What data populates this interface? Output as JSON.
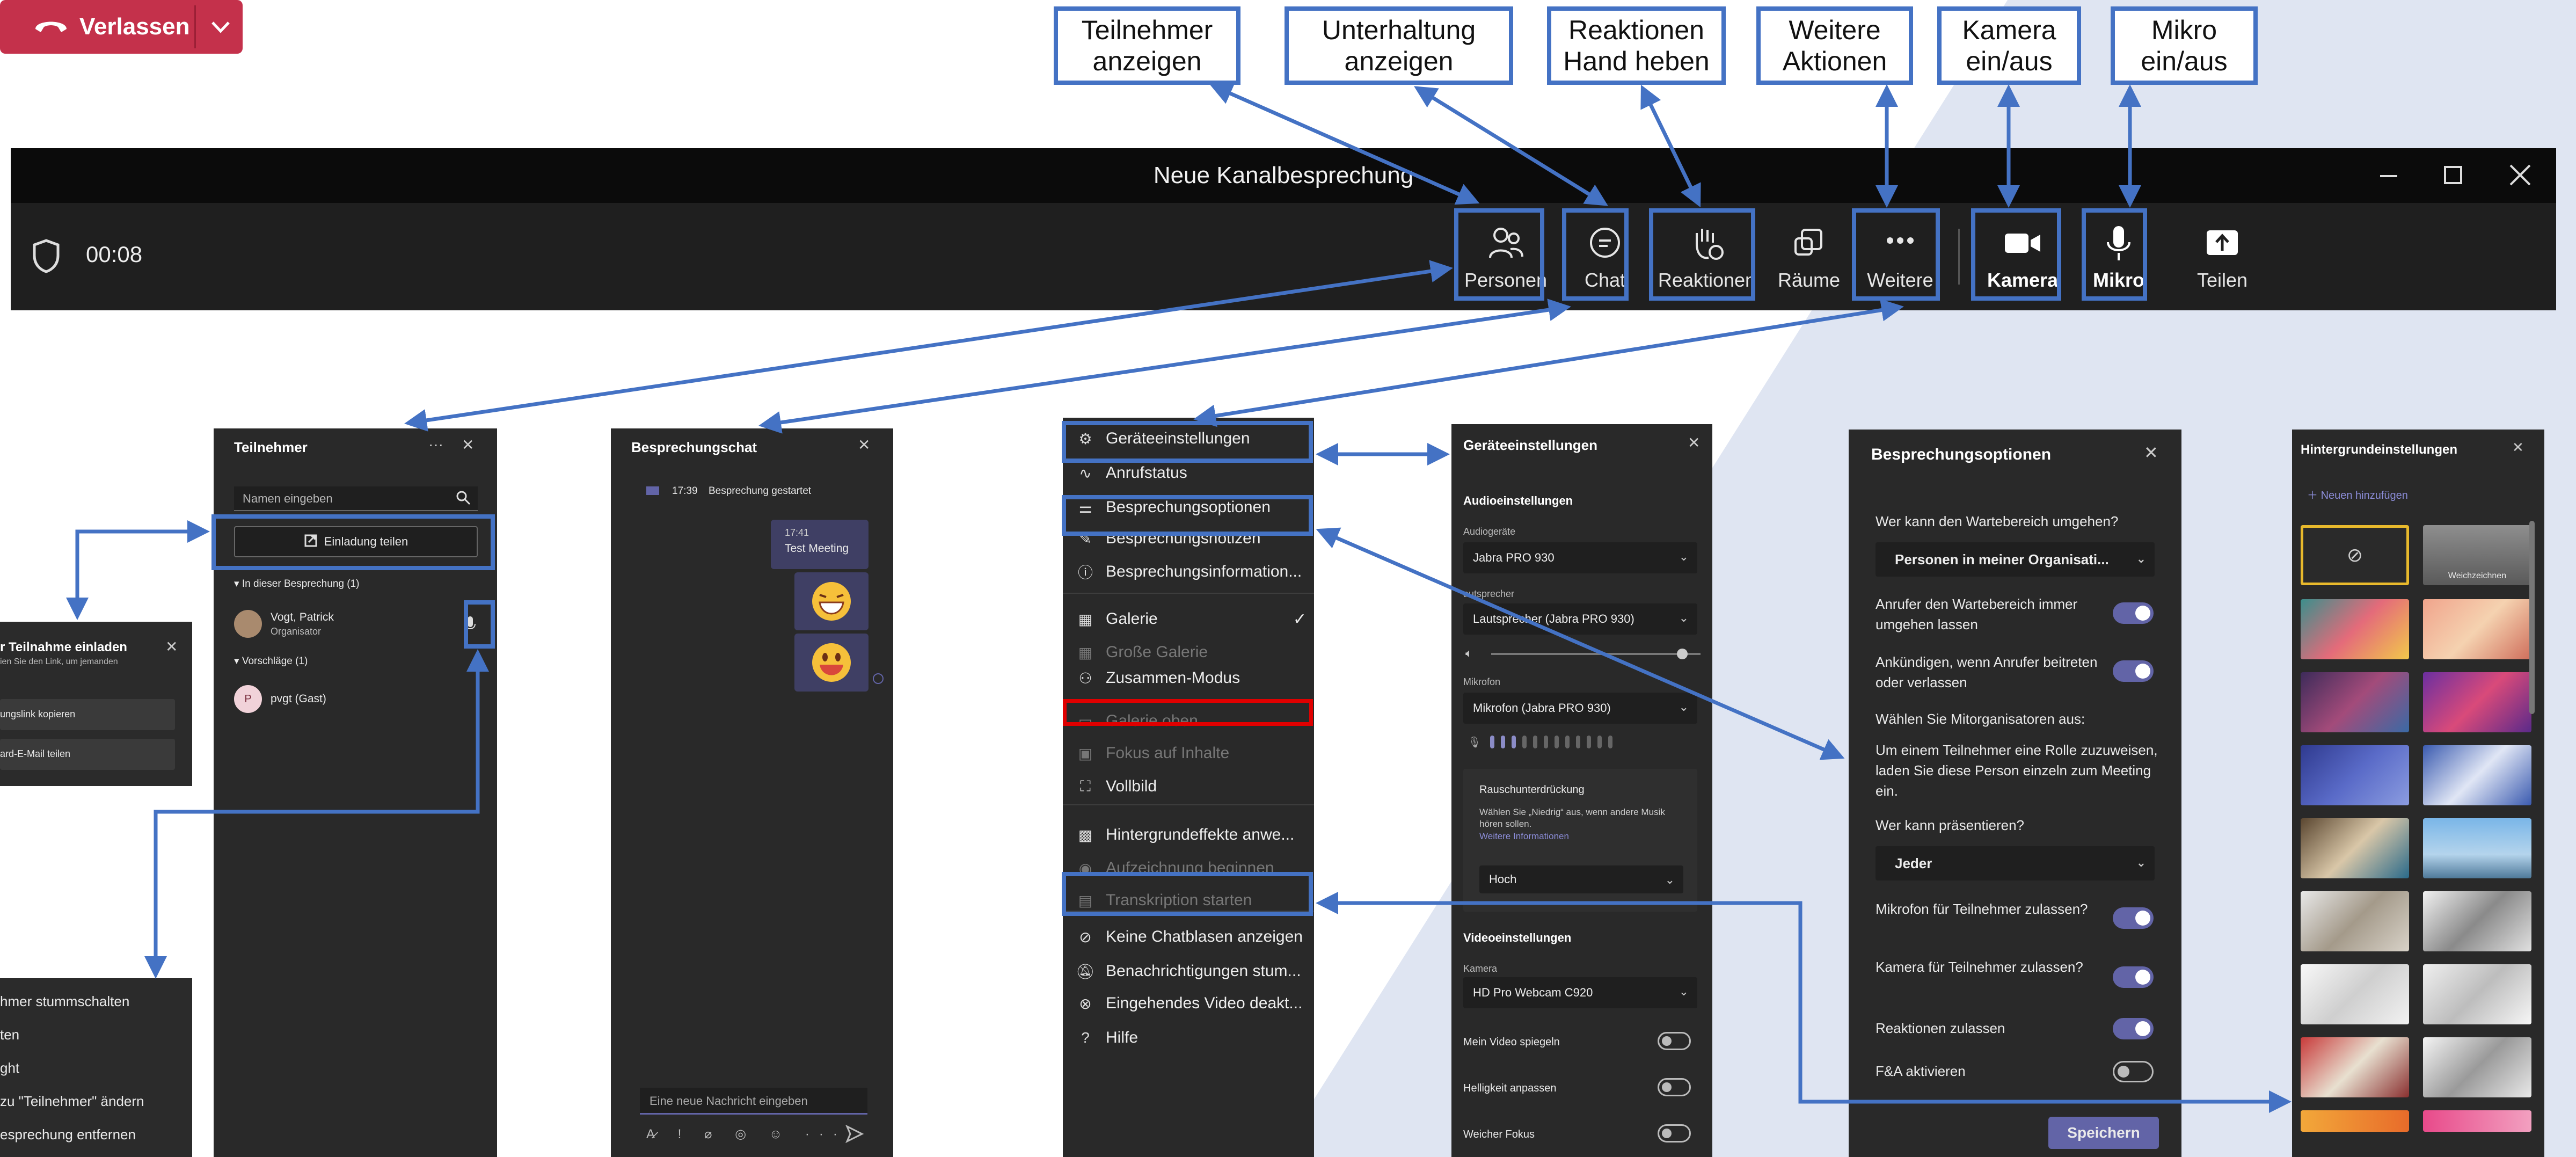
{
  "callouts": [
    {
      "label": "Teilnehmer\nanzeigen"
    },
    {
      "label": "Unterhaltung\nanzeigen"
    },
    {
      "label": "Reaktionen\nHand heben"
    },
    {
      "label": "Weitere\nAktionen"
    },
    {
      "label": "Kamera\nein/aus"
    },
    {
      "label": "Mikro\nein/aus"
    }
  ],
  "window": {
    "title": "Neue Kanalbesprechung",
    "timer": "00:08"
  },
  "toolbar": {
    "personen": "Personen",
    "chat": "Chat",
    "reaktionen": "Reaktionen",
    "raeume": "Räume",
    "weitere": "Weitere",
    "kamera": "Kamera",
    "mikro": "Mikro",
    "teilen": "Teilen",
    "verlassen": "Verlassen"
  },
  "colors": {
    "accent": "#4472c4",
    "leave": "#c4314b",
    "toggle": "#6264a7",
    "panel": "#292929",
    "titlebar": "#0b0b0b",
    "highlight_red": "#e00000"
  },
  "invite_popup": {
    "title": "r Teilnahme einladen",
    "subtitle": "ien Sie den Link, um jemanden",
    "btn1": "ungslink kopieren",
    "btn2": "ard-E-Mail teilen"
  },
  "context_menu": {
    "items": [
      "hmer stummschalten",
      "ten",
      "ght",
      "zu \"Teilnehmer\" ändern",
      "esprechung entfernen"
    ]
  },
  "participants_panel": {
    "title": "Teilnehmer",
    "search_placeholder": "Namen eingeben",
    "invite_button": "Einladung teilen",
    "in_meeting_header": "In dieser Besprechung (1)",
    "person_name": "Vogt, Patrick",
    "person_role": "Organisator",
    "suggestions_header": "Vorschläge (1)",
    "guest_initial": "P",
    "guest_name": "pvgt (Gast)"
  },
  "chat_panel": {
    "title": "Besprechungschat",
    "event_time": "17:39",
    "event_text": "Besprechung gestartet",
    "msg_time": "17:41",
    "msg_text": "Test Meeting",
    "input_placeholder": "Eine neue Nachricht eingeben"
  },
  "more_menu": {
    "items": [
      {
        "label": "Geräteeinstellungen",
        "icon": "gear-icon",
        "disabled": false
      },
      {
        "label": "Anrufstatus",
        "icon": "pulse-icon",
        "disabled": false
      },
      {
        "label": "Besprechungsoptionen",
        "icon": "sliders-icon",
        "disabled": false
      },
      {
        "label": "Besprechungsnotizen",
        "icon": "notes-icon",
        "disabled": false
      },
      {
        "label": "Besprechungsinformation...",
        "icon": "info-icon",
        "disabled": false
      },
      {
        "label": "Galerie",
        "icon": "grid-icon",
        "disabled": false,
        "checked": true
      },
      {
        "label": "Große Galerie",
        "icon": "grid-large-icon",
        "disabled": true
      },
      {
        "label": "Zusammen-Modus",
        "icon": "people-icon",
        "disabled": false
      },
      {
        "label": "Galerie oben",
        "icon": "gallery-top-icon",
        "disabled": true
      },
      {
        "label": "Fokus auf Inhalte",
        "icon": "focus-icon",
        "disabled": true
      },
      {
        "label": "Vollbild",
        "icon": "fullscreen-icon",
        "disabled": false
      },
      {
        "label": "Hintergrundeffekte anwe...",
        "icon": "background-icon",
        "disabled": false
      },
      {
        "label": "Aufzeichnung beginnen",
        "icon": "record-icon",
        "disabled": true
      },
      {
        "label": "Transkription starten",
        "icon": "transcript-icon",
        "disabled": true
      },
      {
        "label": "Keine Chatblasen anzeigen",
        "icon": "chat-off-icon",
        "disabled": false
      },
      {
        "label": "Benachrichtigungen stum...",
        "icon": "bell-off-icon",
        "disabled": false
      },
      {
        "label": "Eingehendes Video deakt...",
        "icon": "video-off-icon",
        "disabled": false
      },
      {
        "label": "Hilfe",
        "icon": "help-icon",
        "disabled": false
      }
    ]
  },
  "device_settings": {
    "title": "Geräteeinstellungen",
    "audio_header": "Audioeinstellungen",
    "audio_devices_label": "Audiogeräte",
    "audio_device": "Jabra PRO 930",
    "speaker_label": "autsprecher",
    "speaker": "Lautsprecher (Jabra PRO 930)",
    "mic_label": "Mikrofon",
    "mic": "Mikrofon (Jabra PRO 930)",
    "noise_label": "Rauschunterdrückung",
    "noise_text": "Wählen Sie „Niedrig“ aus, wenn andere Musik hören sollen.",
    "noise_link": "Weitere Informationen",
    "noise_value": "Hoch",
    "video_header": "Videoeinstellungen",
    "camera_label": "Kamera",
    "camera": "HD Pro Webcam C920",
    "mirror": "Mein Video spiegeln",
    "brightness": "Helligkeit anpassen",
    "soft_focus": "Weicher Fokus"
  },
  "meeting_options": {
    "title": "Besprechungsoptionen",
    "lobby_q": "Wer kann den Wartebereich umgehen?",
    "lobby_value": "Personen in meiner Organisati...",
    "callers_bypass": "Anrufer den Wartebereich immer umgehen lassen",
    "announce": "Ankündigen, wenn Anrufer beitreten oder verlassen",
    "coorganizers": "Wählen Sie Mitorganisatoren aus:",
    "role_text": "Um einem Teilnehmer eine Rolle zuzuweisen, laden Sie diese Person einzeln zum Meeting ein.",
    "present_q": "Wer kann präsentieren?",
    "present_value": "Jeder",
    "allow_mic": "Mikrofon für Teilnehmer zulassen?",
    "allow_camera": "Kamera für Teilnehmer zulassen?",
    "allow_reactions": "Reaktionen zulassen",
    "qa": "F&A aktivieren",
    "save": "Speichern"
  },
  "background_settings": {
    "title": "Hintergrundeinstellungen",
    "add_new": "Neuen hinzufügen",
    "blur_label": "Weichzeichnen"
  }
}
